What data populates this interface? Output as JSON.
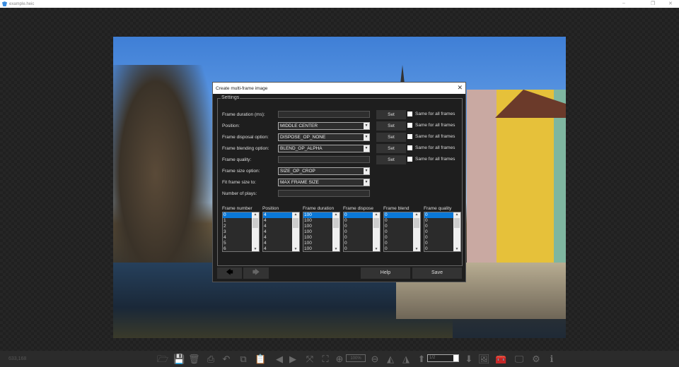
{
  "window": {
    "title": "example.heic",
    "minimize": "–",
    "restore": "❐",
    "close": "✕"
  },
  "dialog": {
    "title": "Create multi-frame image",
    "close": "✕",
    "group_label": "Settings",
    "rows": [
      {
        "label": "Frame duration (ms):",
        "type": "input",
        "value": "",
        "set": "Set",
        "check": "Same for all frames"
      },
      {
        "label": "Position:",
        "type": "select",
        "value": "MIDDLE CENTER",
        "set": "Set",
        "check": "Same for all frames"
      },
      {
        "label": "Frame disposal option:",
        "type": "select",
        "value": "DISPOSE_OP_NONE",
        "set": "Set",
        "check": "Same for all frames"
      },
      {
        "label": "Frame blending option:",
        "type": "select",
        "value": "BLEND_OP_ALPHA",
        "set": "Set",
        "check": "Same for all frames"
      },
      {
        "label": "Frame quality:",
        "type": "input",
        "value": "",
        "set": "Set",
        "check": "Same for all frames"
      },
      {
        "label": "Frame size option:",
        "type": "select",
        "value": "SIZE_OP_CROP"
      },
      {
        "label": "Fit frame size to:",
        "type": "select",
        "value": "MAX FRAME SIZE"
      },
      {
        "label": "Number of plays:",
        "type": "input",
        "value": ""
      }
    ],
    "lists": [
      {
        "header": "Frame number",
        "items": [
          "0",
          "1",
          "2",
          "3",
          "4",
          "5",
          "6"
        ]
      },
      {
        "header": "Position",
        "items": [
          "4",
          "4",
          "4",
          "4",
          "4",
          "4",
          "4"
        ]
      },
      {
        "header": "Frame duration",
        "items": [
          "100",
          "100",
          "100",
          "100",
          "100",
          "100",
          "100"
        ]
      },
      {
        "header": "Frame dispose",
        "items": [
          "0",
          "0",
          "0",
          "0",
          "0",
          "0",
          "0"
        ]
      },
      {
        "header": "Frame blend",
        "items": [
          "0",
          "0",
          "0",
          "0",
          "0",
          "0",
          "0"
        ]
      },
      {
        "header": "Frame quality",
        "items": [
          "0",
          "0",
          "0",
          "0",
          "0",
          "0",
          "0"
        ]
      }
    ],
    "buttons": {
      "back": "🡄",
      "forward": "🡆",
      "help": "Help",
      "save": "Save"
    }
  },
  "status": {
    "coords": "633,168",
    "zoom": "100%",
    "page": "1/2"
  },
  "toolbar_icons": [
    "open-folder-icon",
    "save-icon",
    "delete-icon",
    "print-icon",
    "undo-icon",
    "copy-icon",
    "paste-icon",
    "previous-icon",
    "next-icon",
    "fit-icon",
    "fullscreen-icon",
    "zoom-in-icon",
    "zoom-out-icon",
    "rotate-left-icon",
    "rotate-right-icon",
    "page-up-icon",
    "page-down-icon",
    "image-icon",
    "tools-icon",
    "monitor-icon",
    "settings-icon",
    "info-icon"
  ],
  "colors": {
    "selection": "#0a78d7",
    "dialog_bg": "#1e1e1e",
    "toolbar_bg": "#2b2b2b"
  }
}
